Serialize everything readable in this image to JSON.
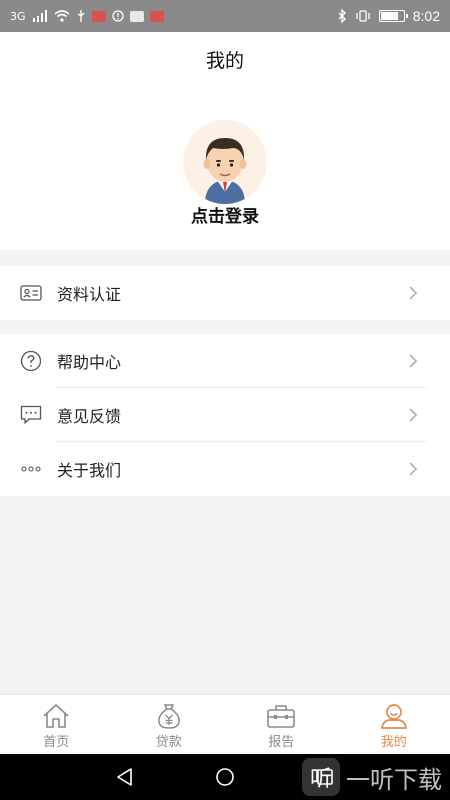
{
  "status_bar": {
    "network_label": "3G",
    "time": "8:02",
    "battery_level": 0.8
  },
  "page": {
    "title": "我的",
    "login_text": "点击登录"
  },
  "menu": {
    "group1": [
      {
        "label": "资料认证",
        "icon": "id-card-icon"
      }
    ],
    "group2": [
      {
        "label": "帮助中心",
        "icon": "question-circle-icon"
      },
      {
        "label": "意见反馈",
        "icon": "feedback-chat-icon"
      },
      {
        "label": "关于我们",
        "icon": "ellipsis-icon"
      }
    ]
  },
  "tabbar": {
    "tabs": [
      {
        "label": "首页",
        "icon": "home-icon"
      },
      {
        "label": "贷款",
        "icon": "money-bag-icon"
      },
      {
        "label": "报告",
        "icon": "briefcase-icon"
      },
      {
        "label": "我的",
        "icon": "user-icon"
      }
    ],
    "active_index": 3,
    "active_color": "#e48a4a",
    "inactive_color": "#8a8a8a"
  },
  "watermark": {
    "text": "一听下载",
    "logo_glyph": "听"
  }
}
